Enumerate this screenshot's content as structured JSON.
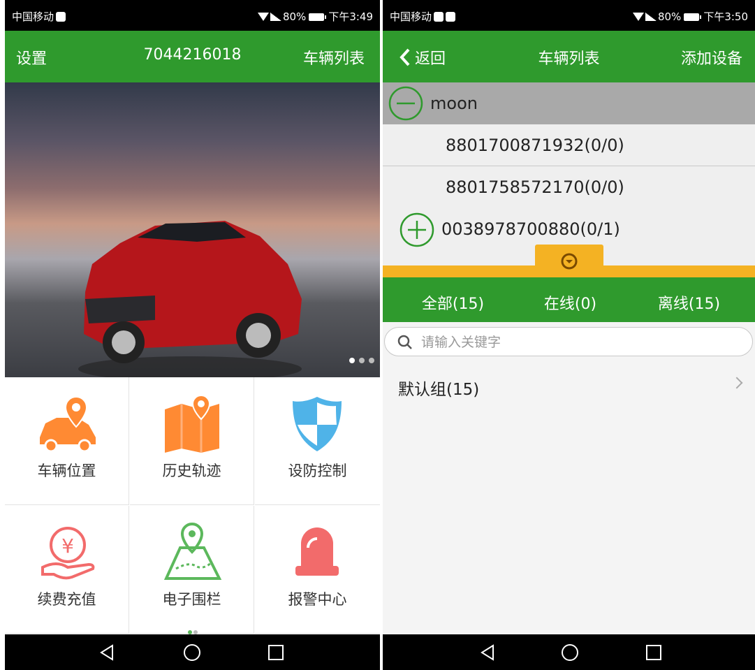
{
  "left": {
    "status": {
      "carrier": "中国移动",
      "battery": "80%",
      "time": "下午3:49"
    },
    "topbar": {
      "settings": "设置",
      "title": "7044216018",
      "vehicle_list": "车辆列表"
    },
    "grid": [
      {
        "label": "车辆位置",
        "icon": "car-location-icon",
        "color": "#ff8a33"
      },
      {
        "label": "历史轨迹",
        "icon": "map-track-icon",
        "color": "#ff8a33"
      },
      {
        "label": "设防控制",
        "icon": "shield-icon",
        "color": "#4fb3e8"
      },
      {
        "label": "续费充值",
        "icon": "yuan-recharge-icon",
        "color": "#f26b6b"
      },
      {
        "label": "电子围栏",
        "icon": "geofence-icon",
        "color": "#5cb85c"
      },
      {
        "label": "报警中心",
        "icon": "alarm-icon",
        "color": "#f26b6b"
      }
    ]
  },
  "right": {
    "status": {
      "carrier": "中国移动",
      "battery": "80%",
      "time": "下午3:50"
    },
    "topbar": {
      "back": "返回",
      "title": "车辆列表",
      "add": "添加设备"
    },
    "tree": {
      "group": "moon",
      "devices": [
        "8801700871932(0/0)",
        "8801758572170(0/0)",
        "0038978700880(0/1)"
      ]
    },
    "tabs": {
      "all": "全部(15)",
      "online": "在线(0)",
      "offline": "离线(15)"
    },
    "search": {
      "placeholder": "请输入关键字",
      "value": ""
    },
    "list": [
      {
        "label": "默认组(15)"
      }
    ]
  },
  "colors": {
    "green": "#2f9a2d",
    "orange": "#ff8a33",
    "blue": "#4fb3e8",
    "red": "#f26b6b",
    "yellow": "#f4b223"
  }
}
